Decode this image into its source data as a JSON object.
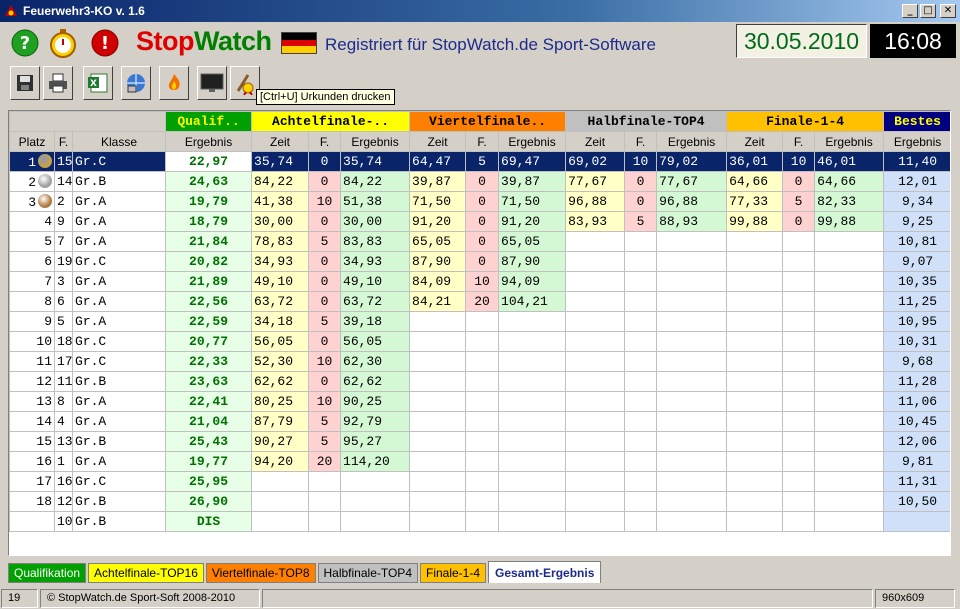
{
  "window": {
    "title": "Feuerwehr3-KO v. 1.6",
    "buttons": {
      "minimize": "_",
      "maximize": "□",
      "close": "✕"
    }
  },
  "header": {
    "brand_stop": "Stop",
    "brand_watch": "Watch",
    "registered": "Registriert für StopWatch.de Sport-Software",
    "date": "30.05.2010",
    "time": "16:08",
    "icons": [
      "help-icon",
      "stopwatch-icon",
      "stop-icon"
    ]
  },
  "toolbar": {
    "tooltip": "[Ctrl+U] Urkunden drucken",
    "buttons": [
      "save-icon",
      "print-icon",
      "excel-icon",
      "network-icon",
      "fire-icon",
      "monitor-icon",
      "certificate-icon"
    ]
  },
  "grid": {
    "sections": {
      "qualif": "Qualif..",
      "achtel": "Achtelfinale-..",
      "viertel": "Viertelfinale..",
      "halb": "Halbfinale-TOP4",
      "finale": "Finale-1-4",
      "bestes": "Bestes"
    },
    "columns": [
      "Platz",
      "F.",
      "Klasse",
      "Ergebnis",
      "Zeit",
      "F.",
      "Ergebnis",
      "Zeit",
      "F.",
      "Ergebnis",
      "Zeit",
      "F.",
      "Ergebnis",
      "Zeit",
      "F.",
      "Ergebnis",
      "Ergebnis"
    ],
    "rows": [
      [
        "1",
        "15",
        "Gr.C",
        "22,97",
        "35,74",
        "0",
        "35,74",
        "64,47",
        "5",
        "69,47",
        "69,02",
        "10",
        "79,02",
        "36,01",
        "10",
        "46,01",
        "11,40"
      ],
      [
        "2",
        "14",
        "Gr.B",
        "24,63",
        "84,22",
        "0",
        "84,22",
        "39,87",
        "0",
        "39,87",
        "77,67",
        "0",
        "77,67",
        "64,66",
        "0",
        "64,66",
        "12,01"
      ],
      [
        "3",
        "2",
        "Gr.A",
        "19,79",
        "41,38",
        "10",
        "51,38",
        "71,50",
        "0",
        "71,50",
        "96,88",
        "0",
        "96,88",
        "77,33",
        "5",
        "82,33",
        "9,34"
      ],
      [
        "4",
        "9",
        "Gr.A",
        "18,79",
        "30,00",
        "0",
        "30,00",
        "91,20",
        "0",
        "91,20",
        "83,93",
        "5",
        "88,93",
        "99,88",
        "0",
        "99,88",
        "9,25"
      ],
      [
        "5",
        "7",
        "Gr.A",
        "21,84",
        "78,83",
        "5",
        "83,83",
        "65,05",
        "0",
        "65,05",
        "",
        "",
        "",
        "",
        "",
        "",
        "10,81"
      ],
      [
        "6",
        "19",
        "Gr.C",
        "20,82",
        "34,93",
        "0",
        "34,93",
        "87,90",
        "0",
        "87,90",
        "",
        "",
        "",
        "",
        "",
        "",
        "9,07"
      ],
      [
        "7",
        "3",
        "Gr.A",
        "21,89",
        "49,10",
        "0",
        "49,10",
        "84,09",
        "10",
        "94,09",
        "",
        "",
        "",
        "",
        "",
        "",
        "10,35"
      ],
      [
        "8",
        "6",
        "Gr.A",
        "22,56",
        "63,72",
        "0",
        "63,72",
        "84,21",
        "20",
        "104,21",
        "",
        "",
        "",
        "",
        "",
        "",
        "11,25"
      ],
      [
        "9",
        "5",
        "Gr.A",
        "22,59",
        "34,18",
        "5",
        "39,18",
        "",
        "",
        "",
        "",
        "",
        "",
        "",
        "",
        "",
        "10,95"
      ],
      [
        "10",
        "18",
        "Gr.C",
        "20,77",
        "56,05",
        "0",
        "56,05",
        "",
        "",
        "",
        "",
        "",
        "",
        "",
        "",
        "",
        "10,31"
      ],
      [
        "11",
        "17",
        "Gr.C",
        "22,33",
        "52,30",
        "10",
        "62,30",
        "",
        "",
        "",
        "",
        "",
        "",
        "",
        "",
        "",
        "9,68"
      ],
      [
        "12",
        "11",
        "Gr.B",
        "23,63",
        "62,62",
        "0",
        "62,62",
        "",
        "",
        "",
        "",
        "",
        "",
        "",
        "",
        "",
        "11,28"
      ],
      [
        "13",
        "8",
        "Gr.A",
        "22,41",
        "80,25",
        "10",
        "90,25",
        "",
        "",
        "",
        "",
        "",
        "",
        "",
        "",
        "",
        "11,06"
      ],
      [
        "14",
        "4",
        "Gr.A",
        "21,04",
        "87,79",
        "5",
        "92,79",
        "",
        "",
        "",
        "",
        "",
        "",
        "",
        "",
        "",
        "10,45"
      ],
      [
        "15",
        "13",
        "Gr.B",
        "25,43",
        "90,27",
        "5",
        "95,27",
        "",
        "",
        "",
        "",
        "",
        "",
        "",
        "",
        "",
        "12,06"
      ],
      [
        "16",
        "1",
        "Gr.A",
        "19,77",
        "94,20",
        "20",
        "114,20",
        "",
        "",
        "",
        "",
        "",
        "",
        "",
        "",
        "",
        "9,81"
      ],
      [
        "17",
        "16",
        "Gr.C",
        "25,95",
        "",
        "",
        "",
        "",
        "",
        "",
        "",
        "",
        "",
        "",
        "",
        "",
        "11,31"
      ],
      [
        "18",
        "12",
        "Gr.B",
        "26,90",
        "",
        "",
        "",
        "",
        "",
        "",
        "",
        "",
        "",
        "",
        "",
        "",
        "10,50"
      ],
      [
        "",
        "10",
        "Gr.B",
        "DIS",
        "",
        "",
        "",
        "",
        "",
        "",
        "",
        "",
        "",
        "",
        "",
        "",
        ""
      ]
    ],
    "medals": {
      "1": "#c8a040",
      "2": "#a0a0a0",
      "3": "#b07840"
    }
  },
  "tabs": [
    {
      "label": "Qualifikation",
      "bg": "#00a000",
      "fg": "#ffffff"
    },
    {
      "label": "Achtelfinale-TOP16",
      "bg": "#ffff00",
      "fg": "#000000"
    },
    {
      "label": "Viertelfinale-TOP8",
      "bg": "#ff8000",
      "fg": "#000000"
    },
    {
      "label": "Halbfinale-TOP4",
      "bg": "#c0c0c0",
      "fg": "#000000"
    },
    {
      "label": "Finale-1-4",
      "bg": "#ffc000",
      "fg": "#000000"
    },
    {
      "label": "Gesamt-Ergebnis",
      "bg": "#ffffff",
      "fg": "#1c2a8c",
      "active": true
    }
  ],
  "status": {
    "count": "19",
    "copyright": "© StopWatch.de Sport-Soft 2008-2010",
    "resolution": "960x609"
  }
}
